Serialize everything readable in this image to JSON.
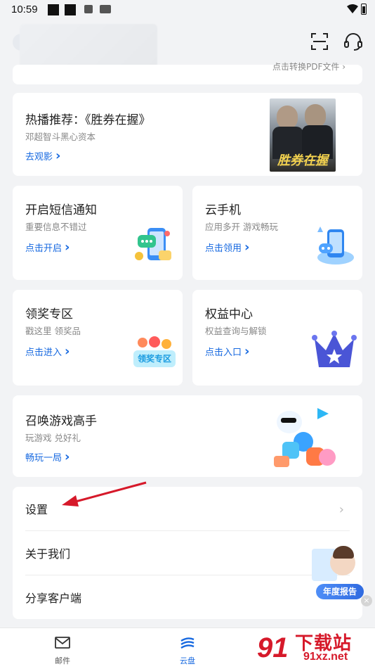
{
  "status_bar": {
    "time": "10:59"
  },
  "top_card": {
    "hint": "点击转换PDF文件 ›"
  },
  "promo": {
    "title": "热播推荐：《胜券在握》",
    "subtitle": "邓超智斗黑心资本",
    "link": "去观影",
    "poster_text": "胜券在握"
  },
  "cards": {
    "sms": {
      "title": "开启短信通知",
      "subtitle": "重要信息不错过",
      "link": "点击开启"
    },
    "cloud_phone": {
      "title": "云手机",
      "subtitle": "应用多开 游戏畅玩",
      "link": "点击领用"
    },
    "prize": {
      "title": "领奖专区",
      "subtitle": "戳这里 领奖品",
      "link": "点击进入",
      "art_text": "领奖专区"
    },
    "benefits": {
      "title": "权益中心",
      "subtitle": "权益查询与解锁",
      "link": "点击入口"
    },
    "games": {
      "title": "召唤游戏高手",
      "subtitle": "玩游戏 兑好礼",
      "link": "畅玩一局"
    }
  },
  "menu": {
    "settings": "设置",
    "about": "关于我们",
    "share": "分享客户端"
  },
  "floating_report": {
    "label": "年度报告"
  },
  "tabbar": {
    "mail": "邮件",
    "cloud": "云盘"
  },
  "watermark": {
    "text": "下载站",
    "url": "91xz.net",
    "logo": "91"
  },
  "colors": {
    "accent": "#1769e0",
    "annotation_arrow": "#d6192a"
  }
}
